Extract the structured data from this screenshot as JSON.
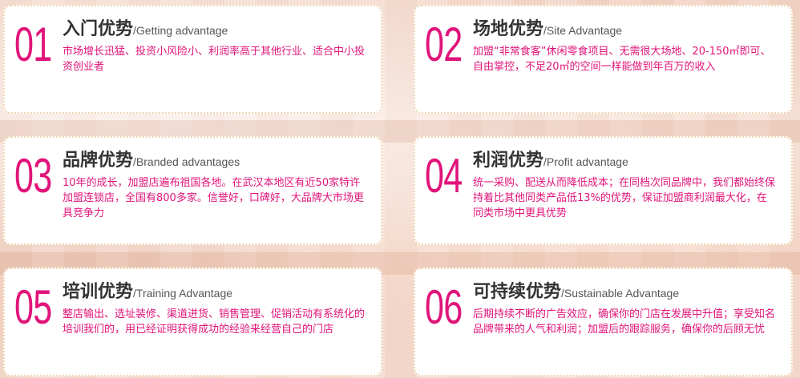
{
  "cards": [
    {
      "num": "01",
      "title": "入门优势",
      "subtitle": "/Getting advantage",
      "desc": "市场增长迅猛、投资小风险小、利润率高于其他行业、适合中小投资创业者"
    },
    {
      "num": "02",
      "title": "场地优势",
      "subtitle": "/Site Advantage",
      "desc": "加盟“非常食客”休闲零食项目、无需很大场地、20-150㎡即可、自由掌控，不足20㎡的空间一样能做到年百万的收入"
    },
    {
      "num": "03",
      "title": "品牌优势",
      "subtitle": "/Branded advantages",
      "desc": "10年的成长，加盟店遍布祖国各地。在武汉本地区有近50家特许加盟连锁店，全国有800多家。信誉好，口碑好，大品牌大市场更具竞争力"
    },
    {
      "num": "04",
      "title": "利润优势",
      "subtitle": "/Profit advantage",
      "desc": "统一采购、配送从而降低成本；在同档次同品牌中，我们都始终保持着比其他同类产品低13%的优势，保证加盟商利润最大化，在同类市场中更具优势"
    },
    {
      "num": "05",
      "title": "培训优势",
      "subtitle": "/Training Advantage",
      "desc": "整店输出、选址装修、渠道进货、销售管理、促销活动有系统化的培训我们的，用已经证明获得成功的经验来经营自己的门店"
    },
    {
      "num": "06",
      "title": "可持续优势",
      "subtitle": "/Sustainable Advantage",
      "desc": "后期持续不断的广告效应，确保你的门店在发展中升值；享受知名品牌带来的人气和利润；加盟后的跟踪服务，确保你的后顾无忧"
    }
  ],
  "colors": {
    "accent": "#e0147a",
    "title": "#333333",
    "subtitle": "#555555",
    "border": "#efd7b6",
    "card_bg": "#ffffff"
  }
}
